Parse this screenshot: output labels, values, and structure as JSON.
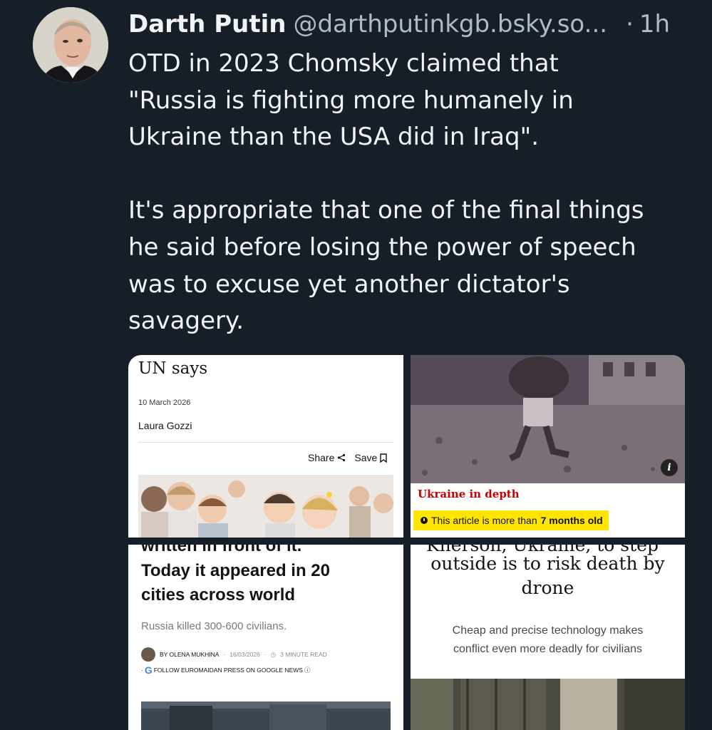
{
  "post": {
    "author": {
      "display_name": "Darth Putin",
      "handle": "@darthputinkgb.bsky.so...",
      "separator": "·",
      "time": "1h"
    },
    "text_lines": [
      "OTD in 2023 Chomsky claimed that",
      "\"Russia is fighting more humanely in",
      "Ukraine than the USA did in Iraq\".",
      "It's appropriate that one of the final things",
      "he said before losing the power of speech",
      "was to excuse yet another dictator's",
      "savagery."
    ]
  },
  "media": {
    "tile1": {
      "headline": "UN says",
      "date": "10 March 2026",
      "author": "Laura Gozzi",
      "share_label": "Share",
      "save_label": "Save",
      "photo_icon": "children-photo"
    },
    "tile2": {
      "photo_icon": "rubble-street-photo",
      "info_label": "i",
      "section": "Ukraine in depth",
      "age_prefix": "This article is more than",
      "age_value": "7 months old"
    },
    "tile3": {
      "cut_line": "written in front of it.",
      "headline_lines": [
        "Today it appeared in 20",
        "cities across world"
      ],
      "subhead": "Russia killed 300-600 civilians.",
      "byline": "BY OLENA MUKHINA",
      "date": "16/03/2026",
      "read_time": "3 MINUTE READ",
      "follow": "FOLLOW EUROMAIDAN PRESS ON GOOGLE NEWS"
    },
    "tile4": {
      "cut_line": "Kherson, Ukraine, to step",
      "headline_lines": [
        "outside is to risk death by",
        "drone"
      ],
      "subhead_lines": [
        "Cheap and precise technology makes",
        "conflict even more deadly for civilians"
      ]
    }
  },
  "colors": {
    "background": "#161e27",
    "secondary_text": "#aebbc9",
    "guardian_red": "#c70000",
    "age_badge": "#ffe500"
  }
}
